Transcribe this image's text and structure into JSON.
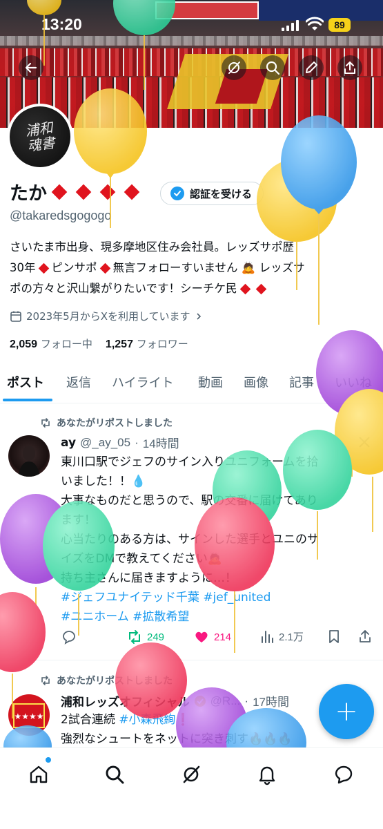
{
  "status": {
    "time": "13:20",
    "battery": "89"
  },
  "profile": {
    "avatar_text": "浦和\n魂書",
    "name": "たか",
    "handle": "@takaredsgogogo",
    "verify_label": "認証を受ける",
    "bio_line1": "さいたま市出身、現多摩地区住み会社員。レッズサポ歴",
    "bio_line2a": "30年",
    "bio_line2b": "ピンサポ",
    "bio_line2c": "無言フォローすいません",
    "bio_line2d": "レッズサ",
    "bio_line3": "ポの方々と沢山繋がりたいです！シーチケ民",
    "joined": "2023年5月からXを利用しています",
    "following_count": "2,059",
    "following_label": "フォロー中",
    "followers_count": "1,257",
    "followers_label": "フォロワー"
  },
  "tabs": [
    "ポスト",
    "返信",
    "ハイライト",
    "動画",
    "画像",
    "記事",
    "いいね"
  ],
  "tweets": [
    {
      "repost_label": "あなたがリポストしました",
      "name": "ay",
      "handle": "@_ay_05",
      "time": "14時間",
      "line1": "東川口駅でジェフのサイン入りユニフォームを拾",
      "line2": "いました！！💧",
      "line3": "大事なものだと思うので、駅の交番に届けてあり",
      "line4": "ます！",
      "line5": "心当たりのある方は、サインした選手とユニのサ",
      "line6": "イズをDMで教えてください🙇",
      "line7": "持ち主さんに届きますように…！",
      "tag1": "#ジェフユナイテッド千葉",
      "tag2": "#jef_united",
      "tag3": "#ユニホーム",
      "tag4": "#拡散希望",
      "reposts": "249",
      "likes": "214",
      "views": "2.1万"
    },
    {
      "repost_label": "あなたがリポストしました",
      "name": "浦和レッズオフィシャル",
      "handle": "@R...",
      "time": "17時間",
      "line1a": "2試合連続",
      "line1b": "#小森飛絢",
      "line1c": "❗️",
      "line2": "強烈なシュートをネットに突き刺す🔥🔥🔥"
    }
  ],
  "colors": {
    "accent": "#1d9bf0",
    "like": "#f91880",
    "repost": "#00ba7c",
    "diamond": "#e0141e"
  }
}
